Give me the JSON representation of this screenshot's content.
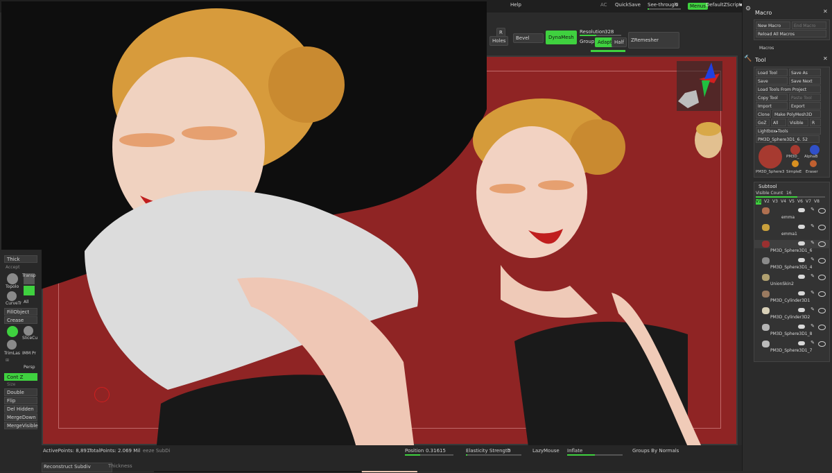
{
  "topbar": {
    "ac": "AC",
    "quicksave": "QuickSave",
    "seethrough_label": "See-through",
    "seethrough_value": "0",
    "menus": "Menus",
    "script": "DefaultZScript",
    "help": "Help"
  },
  "shelf": {
    "r_label": "R",
    "holes": "Holes",
    "bevel": "Bevel",
    "dynamesh": "DynaMesh",
    "resolution_label": "Resolution",
    "resolution_value": "328",
    "group": "Group",
    "adapt": "Adapt",
    "half": "Half",
    "zremesher": "ZRemesher"
  },
  "left": {
    "thick": "Thick",
    "accept": "Accept",
    "transp": "Transp",
    "topology": "Topolo",
    "curve": "CurveTr",
    "all": "All",
    "fill_object": "FillObject",
    "crease": "Crease",
    "slice": "SliceCu",
    "trimlasso": "TrimLas",
    "imm": "IMM Pr",
    "persp": "Persp",
    "cont_z": "Cont Z",
    "size": "Size",
    "double": "Double",
    "flip": "Flip",
    "del_hidden": "Del Hidden",
    "merge_down": "MergeDown",
    "merge_visible": "MergeVisible"
  },
  "macro": {
    "title": "Macro",
    "new_macro": "New Macro",
    "end_macro": "End Macro",
    "reload": "Reload All Macros",
    "macros": "Macros"
  },
  "tool": {
    "title": "Tool",
    "load_tool": "Load Tool",
    "save_as": "Save As",
    "save": "Save",
    "save_next": "Save Next",
    "load_from_project": "Load Tools From Project",
    "copy_tool": "Copy Tool",
    "paste_tool": "Paste Tool",
    "import": "Import",
    "export": "Export",
    "clone": "Clone",
    "make_polymesh": "Make PolyMesh3D",
    "goz": "GoZ",
    "all": "All",
    "visible": "Visible",
    "r": "R",
    "lightbox": "Lightbox▸Tools",
    "current_tool": "PM3D_Sphere3D1_6. 52",
    "thumb_a": "PM3D_Sphere3",
    "thumb_b": "PM3D_",
    "thumb_c": "AlphaB",
    "thumb_d": "SimpleE",
    "thumb_e": "Eraser"
  },
  "subtool": {
    "title": "Subtool",
    "visible_count_label": "Visible Count",
    "visible_count": "16",
    "versions": [
      "V1",
      "V2",
      "V3",
      "V4",
      "V5",
      "V6",
      "V7",
      "V8"
    ],
    "items": [
      {
        "name": "emma",
        "color": "#b07050"
      },
      {
        "name": "emma1",
        "color": "#c9a03c"
      },
      {
        "name": "PM3D_Sphere3D1_6",
        "color": "#9a3030"
      },
      {
        "name": "PM3D_Sphere3D1_4",
        "color": "#8a8a8a"
      },
      {
        "name": "UnionSkin2",
        "color": "#b0a070"
      },
      {
        "name": "PM3D_Cylinder3D1",
        "color": "#9a7a60"
      },
      {
        "name": "PM3D_Cylinder3D2",
        "color": "#d8d0b8"
      },
      {
        "name": "PM3D_Sphere3D1_8",
        "color": "#b5b5b5"
      },
      {
        "name": "PM3D_Sphere3D1_7",
        "color": "#bbbbbb"
      }
    ]
  },
  "bottombar": {
    "active_points": "ActivePoints: 8,891",
    "total_points": "TotalPoints: 2.069 Mil",
    "freeze": "eeze SubDi",
    "position_label": "Position",
    "position_value": "0.31615",
    "elasticity_label": "Elasticity Strength",
    "elasticity_value": "0",
    "lazymouse": "LazyMouse",
    "inflate": "Inflate",
    "groups_by_normals": "Groups By Normals",
    "reconstruct": "Reconstruct Subdiv",
    "thickness": "Thickness"
  },
  "colors": {
    "accent": "#3fd13f",
    "canvas": "#8f2424",
    "panel": "#2b2b2b"
  }
}
